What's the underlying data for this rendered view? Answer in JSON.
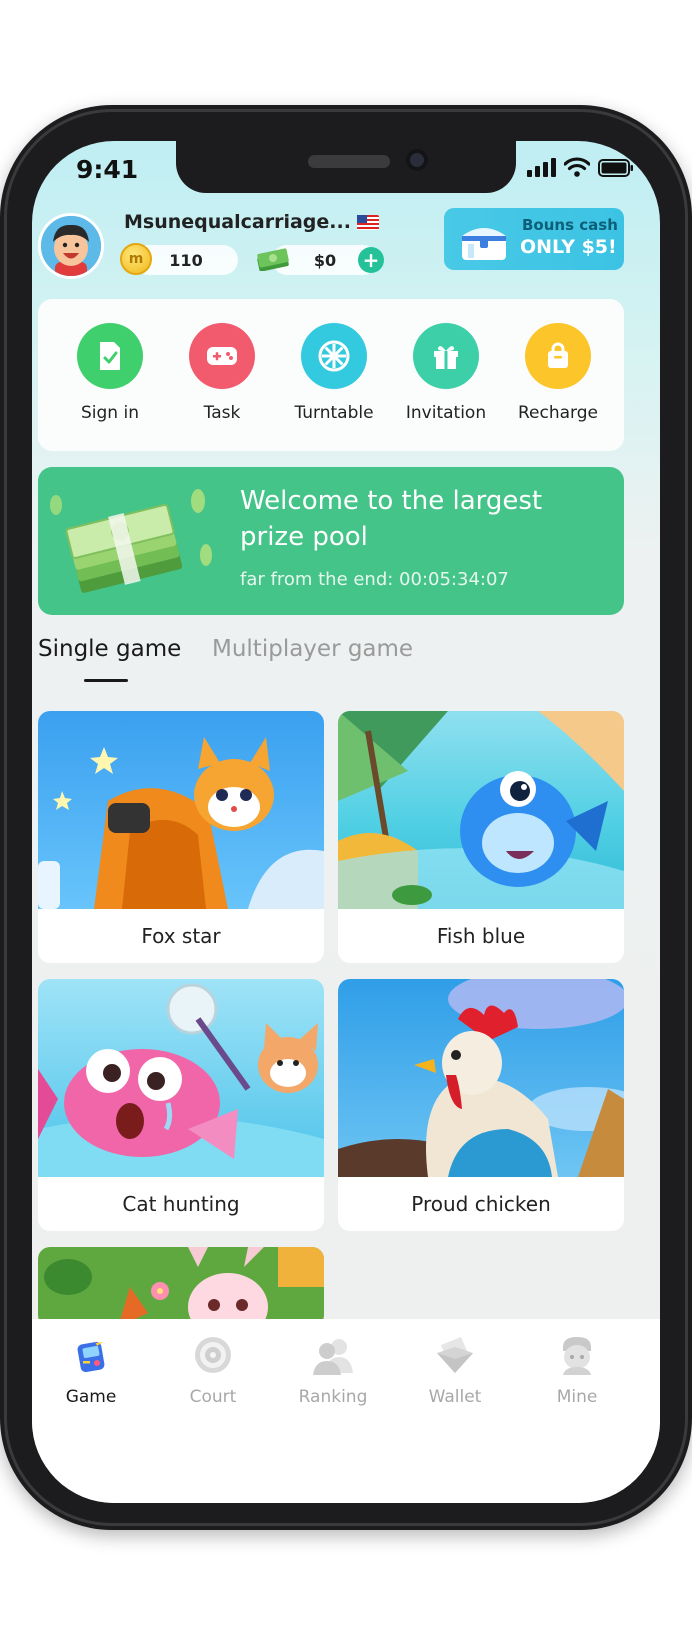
{
  "status_bar": {
    "time": "9:41"
  },
  "profile": {
    "username": "Msunequalcarriage...",
    "coins": "110",
    "cash": "$0",
    "coin_glyph": "m"
  },
  "bonus": {
    "title": "Bouns cash",
    "price": "ONLY $5!"
  },
  "actions": [
    {
      "label": "Sign in",
      "icon": "document-check-icon",
      "color": "#3fcf6d"
    },
    {
      "label": "Task",
      "icon": "gamepad-icon",
      "color": "#f25b6d"
    },
    {
      "label": "Turntable",
      "icon": "wheel-icon",
      "color": "#33c9de"
    },
    {
      "label": "Invitation",
      "icon": "gift-icon",
      "color": "#3dcfa8"
    },
    {
      "label": "Recharge",
      "icon": "bag-icon",
      "color": "#fcc52a"
    }
  ],
  "banner": {
    "title": "Welcome to the largest prize pool",
    "subtitle": "far from the end: 00:05:34:07"
  },
  "tabs": {
    "single": "Single game",
    "multi": "Multiplayer game"
  },
  "games": [
    {
      "title": "Fox star"
    },
    {
      "title": "Fish blue"
    },
    {
      "title": "Cat hunting"
    },
    {
      "title": "Proud chicken"
    }
  ],
  "nav": [
    {
      "label": "Game",
      "icon": "game-icon"
    },
    {
      "label": "Court",
      "icon": "target-icon"
    },
    {
      "label": "Ranking",
      "icon": "people-icon"
    },
    {
      "label": "Wallet",
      "icon": "wallet-icon"
    },
    {
      "label": "Mine",
      "icon": "profile-icon"
    }
  ]
}
